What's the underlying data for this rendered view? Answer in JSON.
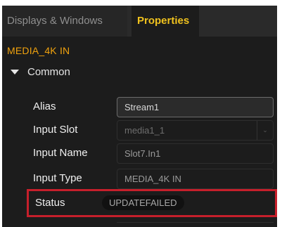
{
  "tabs": [
    {
      "label": "Displays & Windows"
    },
    {
      "label": "Properties"
    }
  ],
  "section_title": "MEDIA_4K IN",
  "group": {
    "label": "Common"
  },
  "properties": {
    "alias": {
      "label": "Alias",
      "value": "Stream1"
    },
    "input_slot": {
      "label": "Input Slot",
      "value": "media1_1"
    },
    "input_name": {
      "label": "Input Name",
      "value": "Slot7.In1"
    },
    "input_type": {
      "label": "Input Type",
      "value": "MEDIA_4K IN"
    },
    "status": {
      "label": "Status",
      "value": "UPDATEFAILED"
    }
  },
  "colors": {
    "active_tab": "#f0c21e",
    "section_title": "#f0a20e",
    "highlight": "#c61f2b",
    "panel_bg": "#1c1c1c"
  },
  "icons": {
    "group_toggle": "caret-down-icon",
    "select_arrow": "chevron-down-icon"
  }
}
